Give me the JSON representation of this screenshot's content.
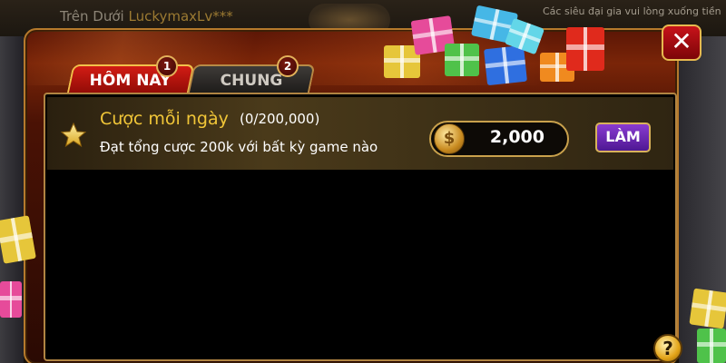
{
  "background": {
    "header_prefix": "Trên Dưới",
    "header_user": "LuckymaxLv***",
    "notice": "Các siêu đại gia vui lòng xuống tiền"
  },
  "tabs": [
    {
      "label": "HÔM NAY",
      "badge": "1",
      "active": true
    },
    {
      "label": "CHUNG",
      "badge": "2",
      "active": false
    }
  ],
  "task": {
    "title": "Cược mỗi ngày",
    "progress": "(0/200,000)",
    "description": "Đạt tổng cược 200k với bất kỳ game nào",
    "reward": "2,000",
    "button_label": "LÀM",
    "coin_glyph": "$"
  },
  "controls": {
    "close_glyph": "✕",
    "help_glyph": "?"
  },
  "colors": {
    "accent_gold": "#f1c638",
    "tab_active": "#d21c14",
    "button_purple": "#8a3bd1",
    "close_red": "#c7131a"
  },
  "icons": {
    "close": "close-icon",
    "help": "help-icon",
    "star": "star-icon",
    "coin": "coin-icon",
    "gifts": "gift-boxes-decoration"
  }
}
